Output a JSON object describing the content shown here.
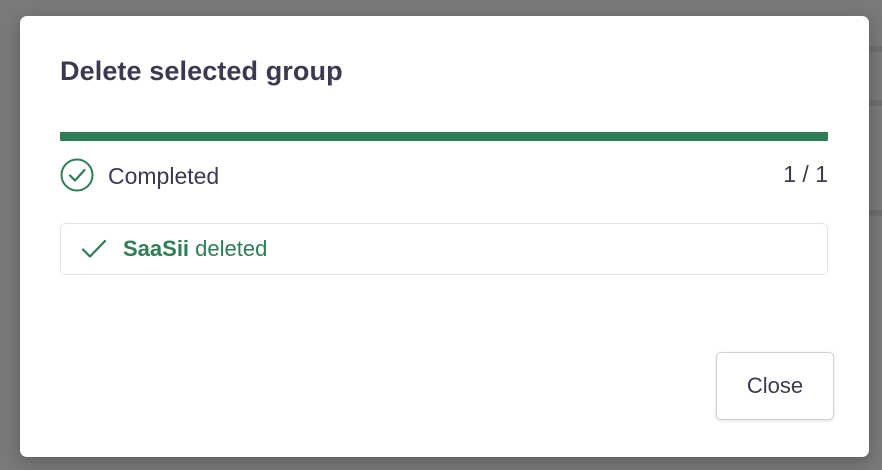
{
  "dialog": {
    "title": "Delete selected group",
    "progress": {
      "fraction": 1.0,
      "color": "#2e7d57"
    },
    "status": {
      "icon": "check-circle-icon",
      "label": "Completed",
      "count": "1 / 1"
    },
    "results": [
      {
        "icon": "checkmark-icon",
        "name": "SaaSii",
        "message": "deleted",
        "color": "#2e7d57"
      }
    ],
    "close_label": "Close"
  }
}
